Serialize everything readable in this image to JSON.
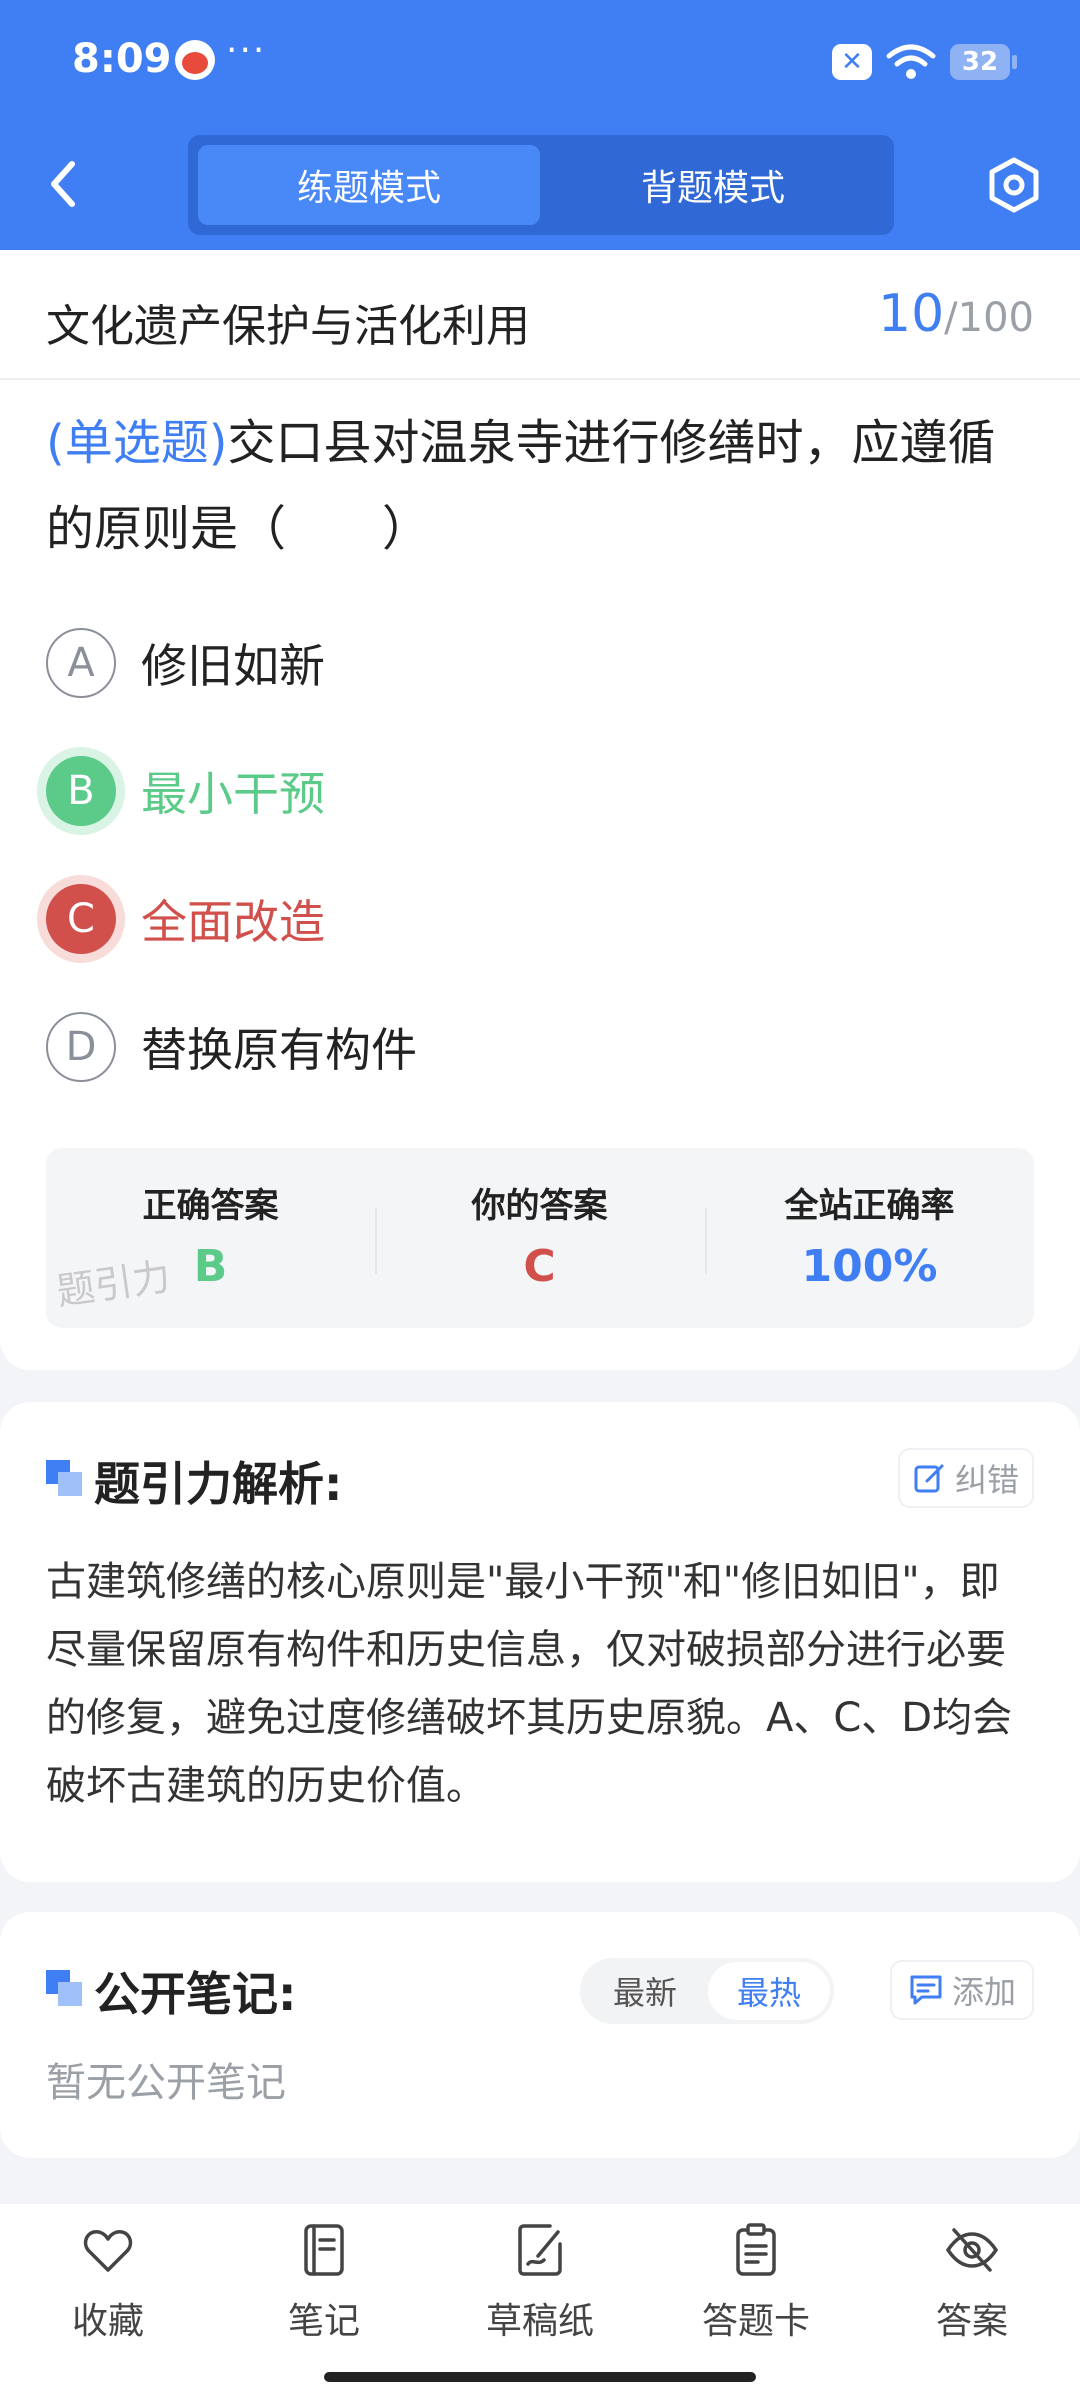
{
  "status_bar": {
    "time": "8:09",
    "dots": "···",
    "battery": "32"
  },
  "header": {
    "modes": [
      "练题模式",
      "背题模式"
    ],
    "active_mode": "练题模式"
  },
  "question_header": {
    "chapter": "文化遗产保护与活化利用",
    "current": "10",
    "total": "/100"
  },
  "question": {
    "type": "(单选题)",
    "text": "交口县对温泉寺进行修缮时，应遵循的原则是（　　）",
    "options": [
      {
        "letter": "A",
        "text": "修旧如新"
      },
      {
        "letter": "B",
        "text": "最小干预"
      },
      {
        "letter": "C",
        "text": "全面改造"
      },
      {
        "letter": "D",
        "text": "替换原有构件"
      }
    ]
  },
  "answer_summary": {
    "correct_label": "正确答案",
    "correct_value": "B",
    "yours_label": "你的答案",
    "yours_value": "C",
    "rate_label": "全站正确率",
    "rate_value": "100%",
    "watermark": "题引力"
  },
  "analysis": {
    "title": "题引力解析:",
    "report_label": "纠错",
    "text": "古建筑修缮的核心原则是\"最小干预\"和\"修旧如旧\"，即尽量保留原有构件和历史信息，仅对破损部分进行必要的修复，避免过度修缮破坏其历史原貌。A、C、D均会破坏古建筑的历史价值。"
  },
  "notes": {
    "title": "公开笔记:",
    "sort_options": [
      "最新",
      "最热"
    ],
    "active_sort": "最热",
    "add_label": "添加",
    "empty_text": "暂无公开笔记"
  },
  "bottom_tabs": [
    {
      "label": "收藏",
      "icon": "heart-icon"
    },
    {
      "label": "笔记",
      "icon": "notebook-icon"
    },
    {
      "label": "草稿纸",
      "icon": "draft-paper-icon"
    },
    {
      "label": "答题卡",
      "icon": "answer-sheet-icon"
    },
    {
      "label": "答案",
      "icon": "eye-off-icon"
    }
  ],
  "colors": {
    "primary": "#3f7ef3",
    "correct": "#5ccb89",
    "wrong": "#d1504b"
  }
}
